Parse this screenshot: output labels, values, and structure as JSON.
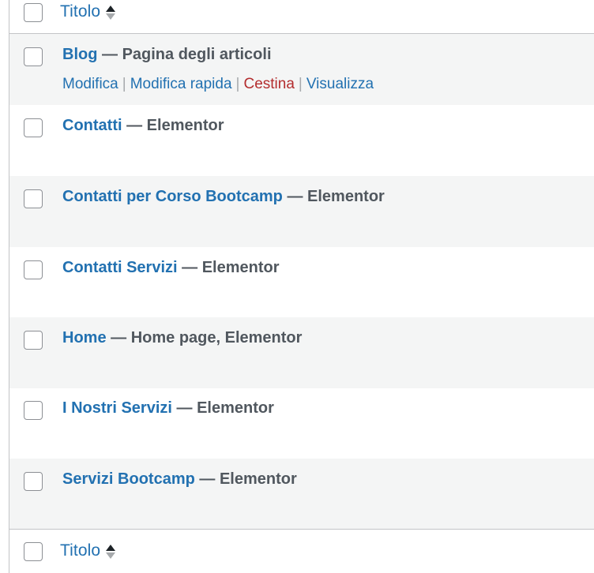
{
  "header": {
    "title_label": "Titolo"
  },
  "footer": {
    "title_label": "Titolo"
  },
  "separator": "—",
  "rows": [
    {
      "title": "Blog",
      "state": "Pagina degli articoli"
    },
    {
      "title": "Contatti",
      "state": "Elementor"
    },
    {
      "title": "Contatti per Corso Bootcamp",
      "state": "Elementor"
    },
    {
      "title": "Contatti Servizi",
      "state": "Elementor"
    },
    {
      "title": "Home",
      "state": "Home page, Elementor"
    },
    {
      "title": "I Nostri Servizi",
      "state": "Elementor"
    },
    {
      "title": "Servizi Bootcamp",
      "state": "Elementor"
    }
  ],
  "row_actions": {
    "edit": "Modifica",
    "quick_edit": "Modifica rapida",
    "trash": "Cestina",
    "view": "Visualizza",
    "divider": "|"
  },
  "colors": {
    "link": "#2271b1",
    "trash": "#b32d2e",
    "text": "#50575e",
    "alt_row": "#f4f5f5",
    "border": "#c3c4c7"
  }
}
